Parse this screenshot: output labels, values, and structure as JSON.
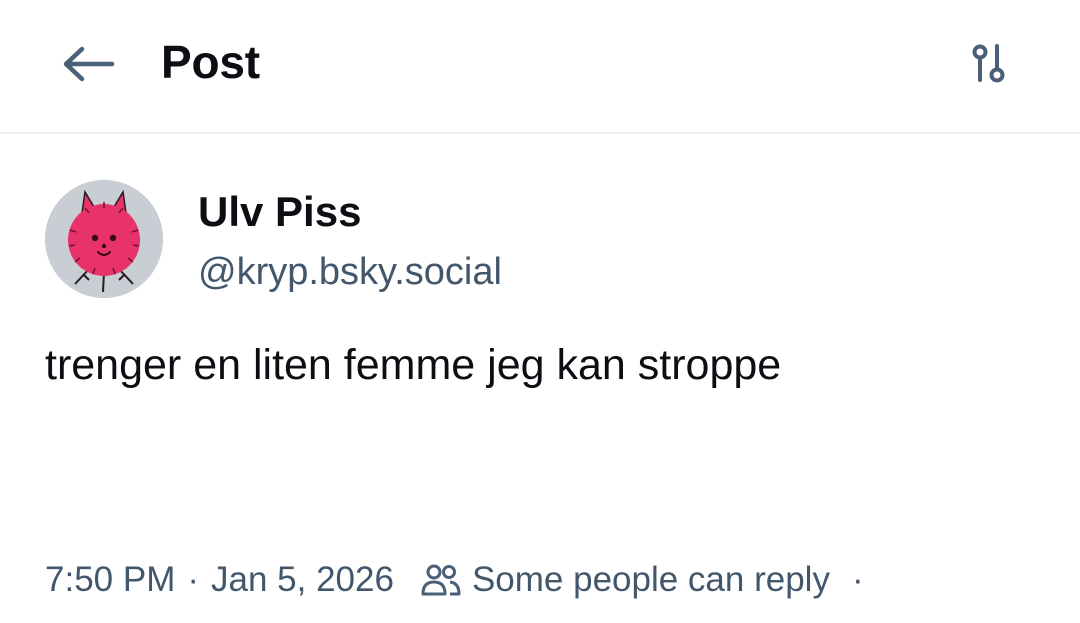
{
  "header": {
    "title": "Post",
    "back_icon": "arrow-left-icon",
    "settings_icon": "sliders-icon"
  },
  "post": {
    "author": {
      "display_name": "Ulv Piss",
      "handle": "@kryp.bsky.social",
      "avatar": "pink-spiky-creature-avatar"
    },
    "text": "trenger en liten femme jeg kan stroppe",
    "time": "7:50 PM",
    "separator": "·",
    "date": "Jan 5, 2026",
    "reply_restriction": "Some people can reply",
    "reply_icon": "people-icon",
    "trailing_dot": "·"
  },
  "colors": {
    "text_primary": "#0b0f14",
    "text_secondary": "#42576c",
    "divider": "#e9edf1",
    "icon": "#4a5f78",
    "avatar_pink": "#e8336a"
  }
}
